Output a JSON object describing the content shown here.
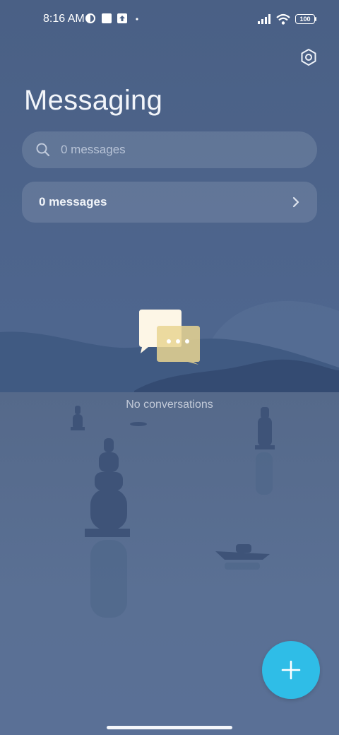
{
  "status_bar": {
    "time": "8:16 AM",
    "battery": "100",
    "icons": [
      "vpn-icon",
      "app-square-icon",
      "upload-icon",
      "dot-icon",
      "signal-icon",
      "wifi-icon",
      "battery-icon"
    ]
  },
  "header": {
    "title": "Messaging",
    "settings_icon": "settings-hex-icon"
  },
  "search": {
    "placeholder": "0 messages",
    "value": ""
  },
  "messages_row": {
    "label": "0 messages"
  },
  "empty_state": {
    "text": "No conversations"
  },
  "fab": {
    "icon": "plus-icon"
  },
  "colors": {
    "background": "#4d6387",
    "accent": "#2fbde7",
    "card": "rgba(255,255,255,0.12)"
  }
}
